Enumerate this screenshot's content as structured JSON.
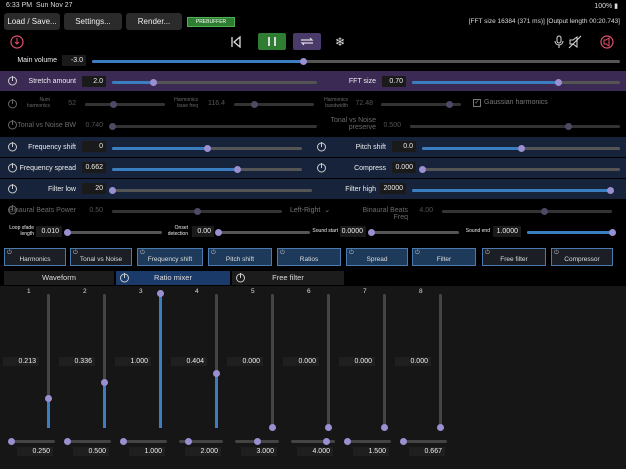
{
  "status": {
    "time": "6:33 PM",
    "date": "Sun Nov 27",
    "battery": "100%"
  },
  "toolbar": {
    "load_save": "Load / Save...",
    "settings": "Settings...",
    "render": "Render...",
    "prebuffer": "PREBUFFER",
    "fft_info": "[FFT size 16384 (371 ms)] [Output length 00:20.743]"
  },
  "main_volume": {
    "label": "Main volume",
    "value": "-3.0",
    "level": 0.4
  },
  "stretch": {
    "label": "Stretch amount",
    "value": "2.0",
    "level": 0.2
  },
  "fft": {
    "label": "FFT size",
    "value": "0.70",
    "level": 0.7
  },
  "harmonics": {
    "num_label": "Num harmonics",
    "num_value": "52",
    "num_level": 0.35,
    "base_label": "Harmonics base freq",
    "base_value": "116.4",
    "base_level": 0.25,
    "bw_label": "Harmonics bandwidth",
    "bw_value": "72.48",
    "bw_level": 0.85,
    "gaussian_label": "Gaussian harmonics"
  },
  "tonal": {
    "label": "Tonal vs Noise BW",
    "value": "0.740",
    "level": 0.0,
    "preserve_label": "Tonal vs Noise preserve",
    "preserve_value": "0.500",
    "preserve_level": 0.75
  },
  "freq_shift": {
    "label": "Frequency shift",
    "value": "0",
    "level": 0.5
  },
  "pitch_shift": {
    "label": "Pitch shift",
    "value": "0.0",
    "level": 0.5
  },
  "freq_spread": {
    "label": "Frequency spread",
    "value": "0.662",
    "level": 0.66
  },
  "compress": {
    "label": "Compress",
    "value": "0.000",
    "level": 0.0
  },
  "filter_low": {
    "label": "Filter low",
    "value": "20",
    "level": 0.0
  },
  "filter_high": {
    "label": "Filter high",
    "value": "20000",
    "level": 1.0
  },
  "binaural": {
    "power_label": "Binaural Beats Power",
    "power_value": "0.50",
    "power_level": 0.5,
    "mode": "Left-Right",
    "freq_label": "Binaural Beats Freq",
    "freq_value": "4.00",
    "freq_level": 0.6
  },
  "loop": {
    "label": "Loop xfade length",
    "value": "0.010",
    "level": 0.0,
    "onset_label": "Onset detection",
    "onset_value": "0.00",
    "onset_level": 0.0,
    "start_label": "Sound start",
    "start_value": "0.0000",
    "start_level": 0.0,
    "end_label": "Sound end",
    "end_value": "1.0000",
    "end_level": 1.0
  },
  "chain": [
    "Harmonics",
    "Tonal vs Noise",
    "Frequency shift",
    "Pitch shift",
    "Ratios",
    "Spread",
    "Filter",
    "Free filter",
    "Compressor"
  ],
  "tabs": {
    "waveform": "Waveform",
    "ratio_mixer": "Ratio mixer",
    "free_filter": "Free filter"
  },
  "mixer": [
    {
      "num": "1",
      "value": "0.213",
      "level": 0.213,
      "ratio": "0.250",
      "ratio_level": 0.0
    },
    {
      "num": "2",
      "value": "0.336",
      "level": 0.336,
      "ratio": "0.500",
      "ratio_level": 0.0
    },
    {
      "num": "3",
      "value": "1.000",
      "level": 1.0,
      "ratio": "1.000",
      "ratio_level": 0.0
    },
    {
      "num": "4",
      "value": "0.404",
      "level": 0.404,
      "ratio": "2.000",
      "ratio_level": 0.2
    },
    {
      "num": "5",
      "value": "0.000",
      "level": 0.0,
      "ratio": "3.000",
      "ratio_level": 0.5
    },
    {
      "num": "6",
      "value": "0.000",
      "level": 0.0,
      "ratio": "4.000",
      "ratio_level": 0.8
    },
    {
      "num": "7",
      "value": "0.000",
      "level": 0.0,
      "ratio": "1.500",
      "ratio_level": 0.0
    },
    {
      "num": "8",
      "value": "0.000",
      "level": 0.0,
      "ratio": "0.667",
      "ratio_level": 0.0
    }
  ],
  "colors": {
    "accent": "#3a7ec0",
    "knob": "#9a8fd0",
    "highlight": "#3a2a54",
    "red_icon": "#e0506a"
  }
}
